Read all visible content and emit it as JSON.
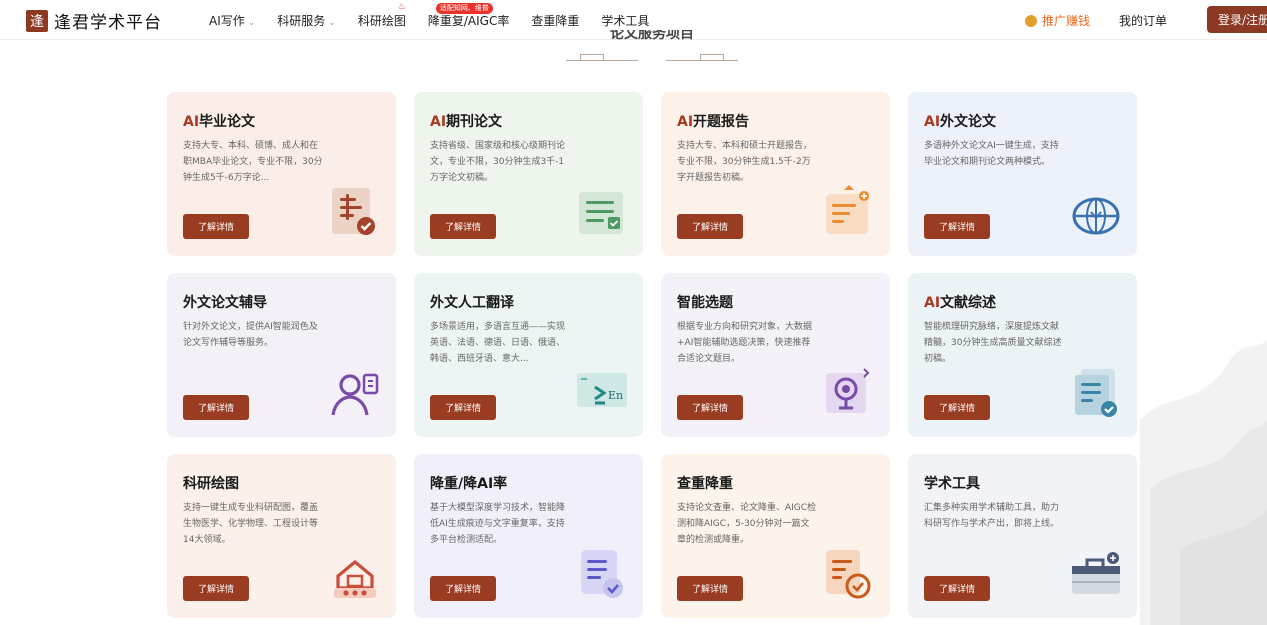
{
  "brand": {
    "mark": "逢",
    "name": "逢君学术平台"
  },
  "nav": {
    "items": [
      {
        "label": "AI写作",
        "caret": "⌄"
      },
      {
        "label": "科研服务",
        "caret": "⌄"
      },
      {
        "label": "科研绘图",
        "caret": ""
      },
      {
        "label": "降重复/AIGC率",
        "caret": "",
        "badge": "适配知网、维普"
      },
      {
        "label": "查重降重",
        "caret": ""
      },
      {
        "label": "学术工具",
        "caret": ""
      }
    ],
    "promo_label": "推广赚钱",
    "orders_label": "我的订单",
    "login_label": "登录/注册"
  },
  "section": {
    "title": "论文服务项目"
  },
  "cards": [
    {
      "title_ai": "AI",
      "title_rest": "毕业论文",
      "desc": "支持大专、本科、硕博、成人和在职MBA毕业论文，专业不限，30分钟生成5千-6万字论...",
      "button": "了解详情",
      "icon": "thesis-check-icon",
      "accent": "#a2442a"
    },
    {
      "title_ai": "AI",
      "title_rest": "期刊论文",
      "desc": "支持省级、国家级和核心级期刊论文，专业不限，30分钟生成3千-1万字论文初稿。",
      "button": "了解详情",
      "icon": "journal-list-icon",
      "accent": "#4e9a62"
    },
    {
      "title_ai": "AI",
      "title_rest": "开题报告",
      "desc": "支持大专、本科和硕士开题报告，专业不限，30分钟生成1.5千-2万字开题报告初稿。",
      "button": "了解详情",
      "icon": "proposal-doc-icon",
      "accent": "#ee8a30"
    },
    {
      "title_ai": "AI",
      "title_rest": "外文论文",
      "desc": "多语种外文论文AI一键生成，支持毕业论文和期刊论文两种模式。",
      "button": "了解详情",
      "icon": "globe-icon",
      "accent": "#3a72b0"
    },
    {
      "title_ai": "",
      "title_rest": "外文论文辅导",
      "desc": "针对外文论文，提供AI智能润色及论文写作辅导等服务。",
      "button": "了解详情",
      "icon": "tutor-user-icon",
      "accent": "#7a4aa8"
    },
    {
      "title_ai": "",
      "title_rest": "外文人工翻译",
      "desc": "多场景适用，多语言互通——实现英语、法语、德语、日语、俄语、韩语、西班牙语、意大...",
      "button": "了解详情",
      "icon": "translate-icon",
      "accent": "#3aa6a0"
    },
    {
      "title_ai": "",
      "title_rest": "智能选题",
      "desc": "根据专业方向和研究对象，大数据+AI智能辅助选题决策，快速推荐合适论文题目。",
      "button": "了解详情",
      "icon": "topic-target-icon",
      "accent": "#7a4aa8"
    },
    {
      "title_ai": "AI",
      "title_rest": "文献综述",
      "desc": "智能梳理研究脉络，深度提炼文献精髓，30分钟生成高质量文献综述初稿。",
      "button": "了解详情",
      "icon": "literature-review-icon",
      "accent": "#3a86a6"
    },
    {
      "title_ai": "",
      "title_rest": "科研绘图",
      "desc": "支持一键生成专业科研配图，覆盖生物医学、化学物理、工程设计等14大领域。",
      "button": "了解详情",
      "icon": "research-drawing-icon",
      "accent": "#c8503a"
    },
    {
      "title_ai": "",
      "title_rest": "降重/降AI率",
      "desc": "基于大模型深度学习技术，智能降低AI生成痕迹与文字重复率，支持多平台检测适配。",
      "button": "了解详情",
      "icon": "reduce-rate-icon",
      "accent": "#5a5ac8"
    },
    {
      "title_ai": "",
      "title_rest": "查重降重",
      "desc": "支持论文查重、论文降重、AIGC检测和降AIGC，5-30分钟对一篇文章的检测或降重。",
      "button": "了解详情",
      "icon": "plagiarism-check-icon",
      "accent": "#c85a1a"
    },
    {
      "title_ai": "",
      "title_rest": "学术工具",
      "desc": "汇集多种实用学术辅助工具，助力科研写作与学术产出，即将上线。",
      "button": "了解详情",
      "icon": "toolbox-icon",
      "accent": "#4a5a78"
    }
  ]
}
